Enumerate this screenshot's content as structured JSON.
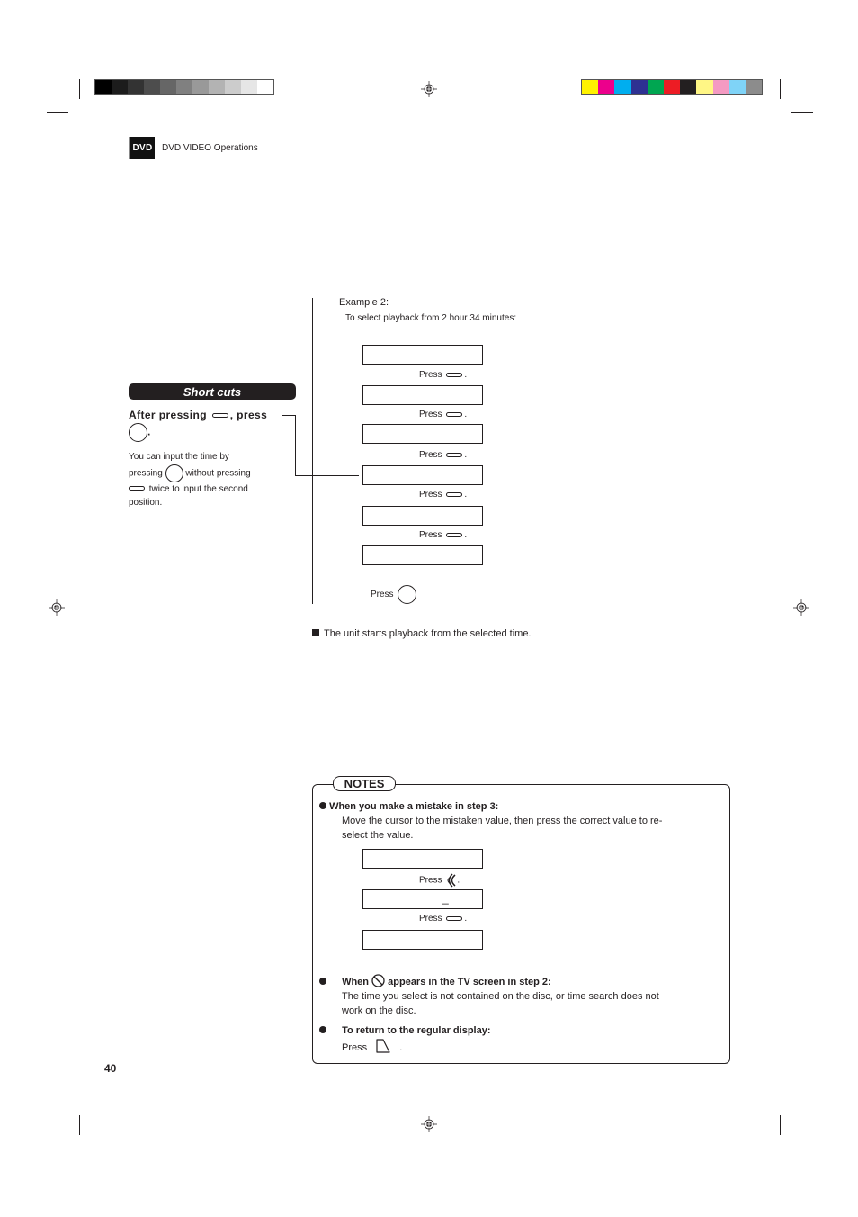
{
  "print_marks": {
    "grey_strip": [
      "#000000",
      "#1c1c1c",
      "#333333",
      "#4d4d4d",
      "#666666",
      "#808080",
      "#999999",
      "#b3b3b3",
      "#cccccc",
      "#e6e6e6",
      "#ffffff"
    ],
    "color_strip": [
      "#fff200",
      "#ec008c",
      "#00aeef",
      "#2e3192",
      "#00a651",
      "#ed1c24",
      "#231f20",
      "#fff685",
      "#f49ac2",
      "#7fd3f7",
      "#8c8c8c"
    ]
  },
  "header": {
    "logo": "DVD",
    "title": "DVD VIDEO Operations"
  },
  "sidebar": {
    "shortcuts_title": "Short cuts",
    "heading_part1": "After pressing",
    "heading_part2": ", press",
    "heading_end": ".",
    "body_line1": "You can input the time by",
    "body_line2a": "pressing",
    "body_line2b": "without pressing",
    "body_line3": "twice to input the second",
    "body_line4": "position."
  },
  "example": {
    "title": "Example 2:",
    "subtitle": "To select playback from 2 hour 34 minutes:",
    "press_label": "Press",
    "steps": [
      {
        "press": "Press",
        "button": "oval-button"
      },
      {
        "press": "Press",
        "button": "oval-button"
      },
      {
        "press": "Press",
        "button": "oval-button"
      },
      {
        "press": "Press",
        "button": "oval-button"
      },
      {
        "press": "Press",
        "button": "oval-button"
      }
    ],
    "final_press": "Press",
    "result": "The unit starts playback from the selected time."
  },
  "notes": {
    "label": "NOTES",
    "items": [
      {
        "title": "When you make a mistake in step 3:",
        "body_line1": "Move the cursor to the mistaken value, then press the correct value to re-",
        "body_line2": "select the value.",
        "press1": "Press",
        "press2": "Press",
        "cursor": "_"
      },
      {
        "title_a": "When",
        "title_b": "appears in the TV screen in step 2:",
        "body_line1": "The time you select is not contained on the disc, or time search does not",
        "body_line2": "work on the disc."
      },
      {
        "title": "To return to the regular display:",
        "press": "Press",
        "end": "."
      }
    ]
  },
  "footer": {
    "page_number": "40"
  }
}
